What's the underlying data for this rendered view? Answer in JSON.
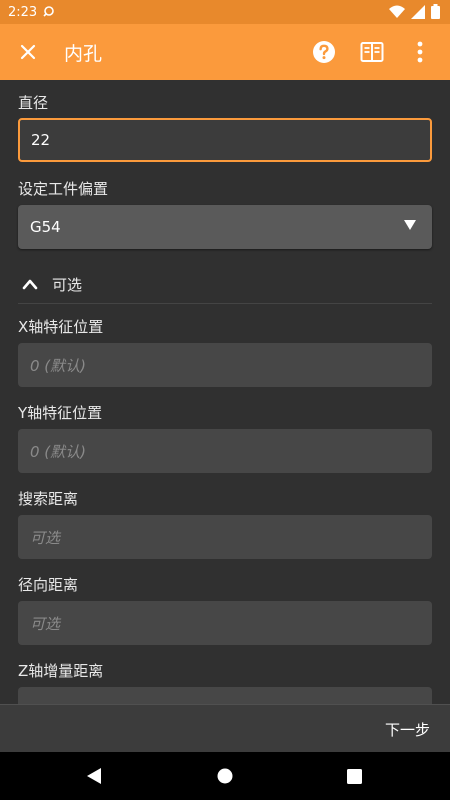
{
  "status_bar": {
    "time": "2:23"
  },
  "app_bar": {
    "title": "内孔"
  },
  "form": {
    "diameter_label": "直径",
    "diameter_value": "22",
    "offset_label": "设定工件偏置",
    "offset_value": "G54",
    "optional_label": "可选",
    "x_label": "X轴特征位置",
    "x_placeholder": "0 (默认)",
    "y_label": "Y轴特征位置",
    "y_placeholder": "0 (默认)",
    "search_label": "搜索距离",
    "search_placeholder": "可选",
    "radial_label": "径向距离",
    "radial_placeholder": "可选",
    "z_label": "Z轴增量距离"
  },
  "bottom": {
    "next_label": "下一步"
  },
  "colors": {
    "accent": "#fb9a3c",
    "status_bar": "#e8892c",
    "background": "#303030"
  }
}
